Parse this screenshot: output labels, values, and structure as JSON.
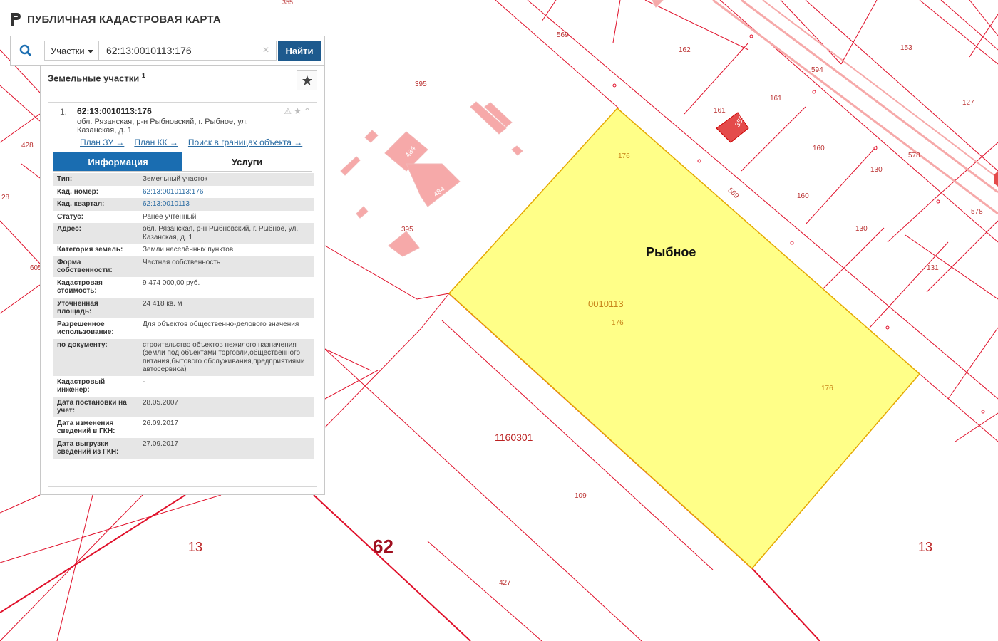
{
  "header": {
    "title": "ПУБЛИЧНАЯ КАДАСТРОВАЯ КАРТА"
  },
  "search": {
    "layer": "Участки",
    "query": "62:13:0010113:176",
    "clear": "×",
    "button": "Найти"
  },
  "panel": {
    "title": "Земельные участки",
    "count": "1",
    "result": {
      "index": "1.",
      "number": "62:13:0010113:176",
      "address": "обл. Рязанская, р-н Рыбновский, г. Рыбное, ул. Казанская, д. 1",
      "links": [
        "План ЗУ →",
        "План КК →",
        "Поиск в границах объекта →"
      ]
    },
    "tabs": [
      "Информация",
      "Услуги"
    ],
    "rows": [
      {
        "key": "Тип:",
        "value": "Земельный участок"
      },
      {
        "key": "Кад. номер:",
        "value": "62:13:0010113:176",
        "link": true
      },
      {
        "key": "Кад. квартал:",
        "value": "62:13:0010113",
        "link": true
      },
      {
        "key": "Статус:",
        "value": "Ранее учтенный"
      },
      {
        "key": "Адрес:",
        "value": "обл. Рязанская, р-н Рыбновский, г. Рыбное, ул. Казанская, д. 1"
      },
      {
        "key": "Категория земель:",
        "value": "Земли населённых пунктов"
      },
      {
        "key": "Форма собственности:",
        "value": "Частная собственность"
      },
      {
        "key": "Кадастровая стоимость:",
        "value": "9 474 000,00 руб."
      },
      {
        "key": "Уточненная площадь:",
        "value": "24 418 кв. м"
      },
      {
        "key": "Разрешенное использование:",
        "value": "Для объектов общественно-делового значения"
      },
      {
        "key": "по документу:",
        "value": "строительство объектов нежилого назначения (земли под объектами торговли,общественного питания,бытового обслуживания,предприятиями автосервиса)"
      },
      {
        "key": "Кадастровый инженер:",
        "value": "-"
      },
      {
        "key": "Дата постановки на учет:",
        "value": "28.05.2007"
      },
      {
        "key": "Дата изменения сведений в ГКН:",
        "value": "26.09.2017"
      },
      {
        "key": "Дата выгрузки сведений из ГКН:",
        "value": "27.09.2017"
      }
    ]
  },
  "map": {
    "town": "Рыбное",
    "quarter": "0010113",
    "big_labels": [
      "13",
      "62",
      "13"
    ],
    "quarter2": "1160301",
    "parcel_labels": [
      "176",
      "176",
      "176",
      "569",
      "569",
      "395",
      "395",
      "484",
      "484",
      "162",
      "161",
      "161",
      "160",
      "160",
      "153",
      "594",
      "127",
      "578",
      "578",
      "130",
      "130",
      "131",
      "109",
      "427",
      "428",
      "605",
      "28",
      "675",
      "355"
    ],
    "colors": {
      "boundary": "#e0102a",
      "selected_fill": "#ffff88",
      "selected_stroke": "#e5a800",
      "building": "#f6a9a9"
    }
  }
}
